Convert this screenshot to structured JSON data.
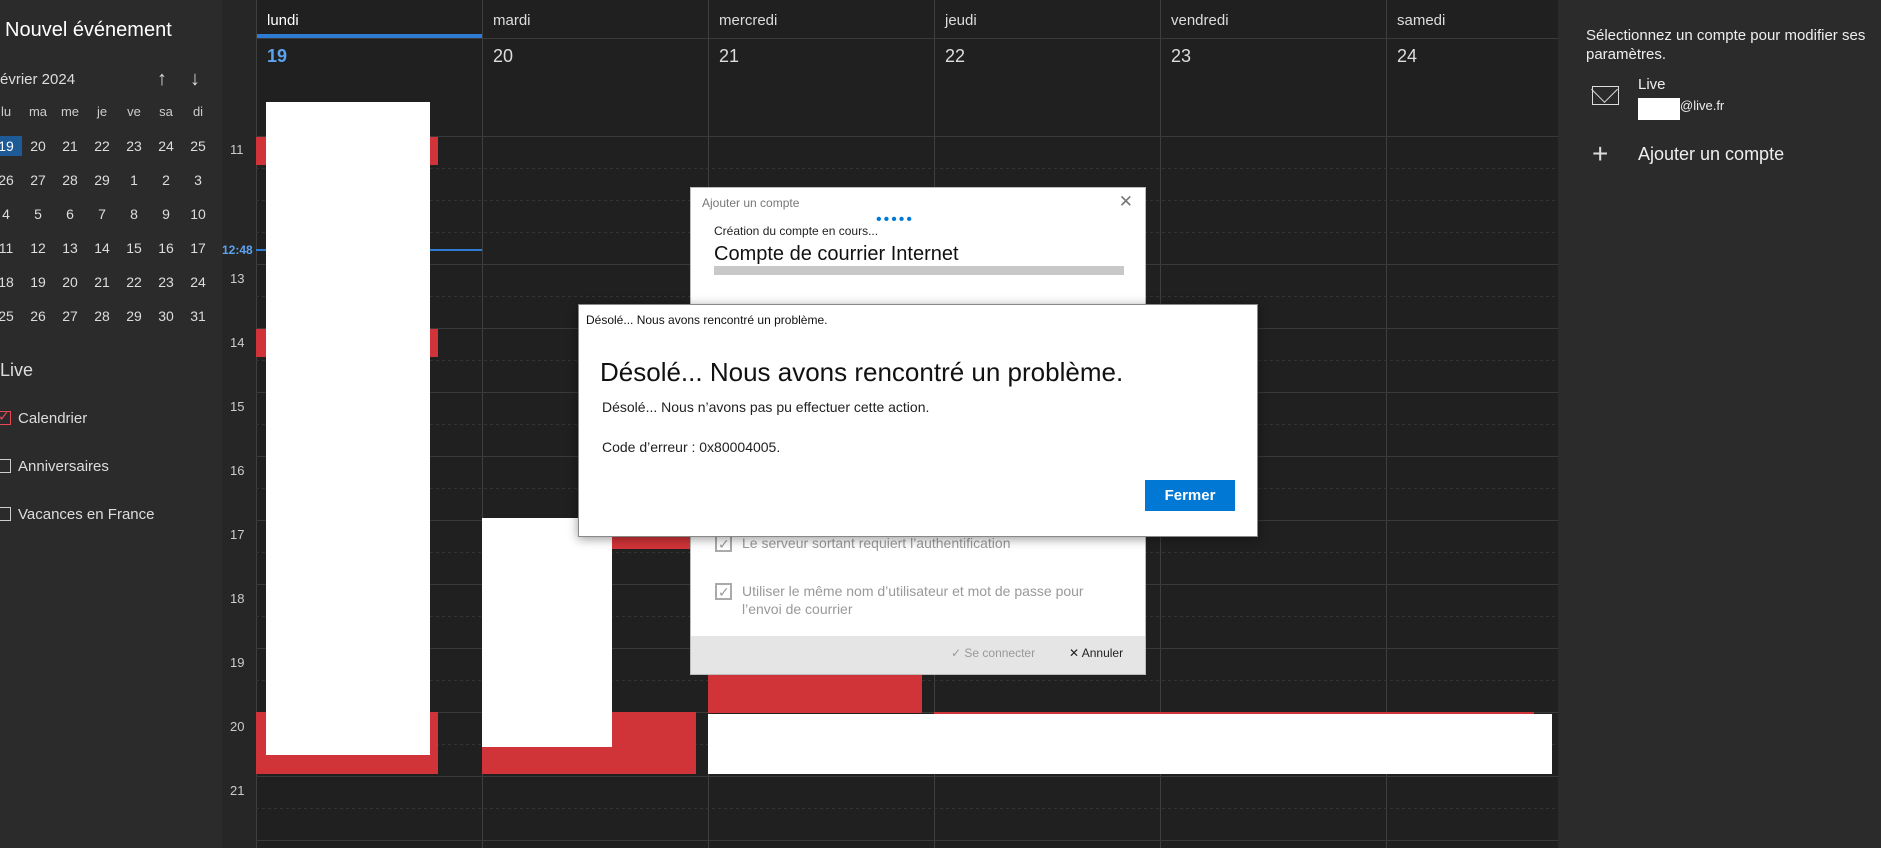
{
  "left_pane": {
    "new_event": "Nouvel événement",
    "month": "évrier 2024",
    "mini_calendar": {
      "weekdays": [
        "lu",
        "ma",
        "me",
        "je",
        "ve",
        "sa",
        "di"
      ],
      "weeks": [
        [
          "19",
          "20",
          "21",
          "22",
          "23",
          "24",
          "25"
        ],
        [
          "26",
          "27",
          "28",
          "29",
          "1",
          "2",
          "3"
        ],
        [
          "4",
          "5",
          "6",
          "7",
          "8",
          "9",
          "10"
        ],
        [
          "11",
          "12",
          "13",
          "14",
          "15",
          "16",
          "17"
        ],
        [
          "18",
          "19",
          "20",
          "21",
          "22",
          "23",
          "24"
        ],
        [
          "25",
          "26",
          "27",
          "28",
          "29",
          "30",
          "31"
        ]
      ],
      "selected": "19"
    },
    "account_label": "Live",
    "calendars": [
      {
        "label": "Calendrier",
        "checked": true
      },
      {
        "label": "Anniversaires",
        "checked": false
      },
      {
        "label": "Vacances en France",
        "checked": false
      }
    ]
  },
  "calendar": {
    "days": [
      {
        "name": "lundi",
        "num": "19",
        "today": true
      },
      {
        "name": "mardi",
        "num": "20"
      },
      {
        "name": "mercredi",
        "num": "21"
      },
      {
        "name": "jeudi",
        "num": "22"
      },
      {
        "name": "vendredi",
        "num": "23"
      },
      {
        "name": "samedi",
        "num": "24"
      }
    ],
    "hours": [
      "11",
      "13",
      "14",
      "15",
      "16",
      "17",
      "18",
      "19",
      "20",
      "21"
    ],
    "now_label": "12:48",
    "event_color": "#d13438"
  },
  "account_pane": {
    "instruction": "Sélectionnez un compte pour modifier ses paramètres.",
    "account_name": "Live",
    "account_email": "@live.fr",
    "add_account": "Ajouter un compte"
  },
  "add_account_dialog": {
    "title": "Ajouter un compte",
    "creating": "Création du compte en cours...",
    "heading": "Compte de courrier Internet",
    "options": [
      "Le serveur sortant requiert l’authentification",
      "Utiliser le même nom d’utilisateur et mot de passe pour l’envoi de courrier"
    ],
    "connect": "Se connecter",
    "cancel": "Annuler"
  },
  "error_dialog": {
    "title": "Désolé... Nous avons rencontré un problème.",
    "heading": "Désolé... Nous avons rencontré un problème.",
    "message": "Désolé... Nous n’avons pas pu effectuer cette action.",
    "code": "Code d’erreur : 0x80004005.",
    "button": "Fermer",
    "accent": "#0078d4"
  }
}
